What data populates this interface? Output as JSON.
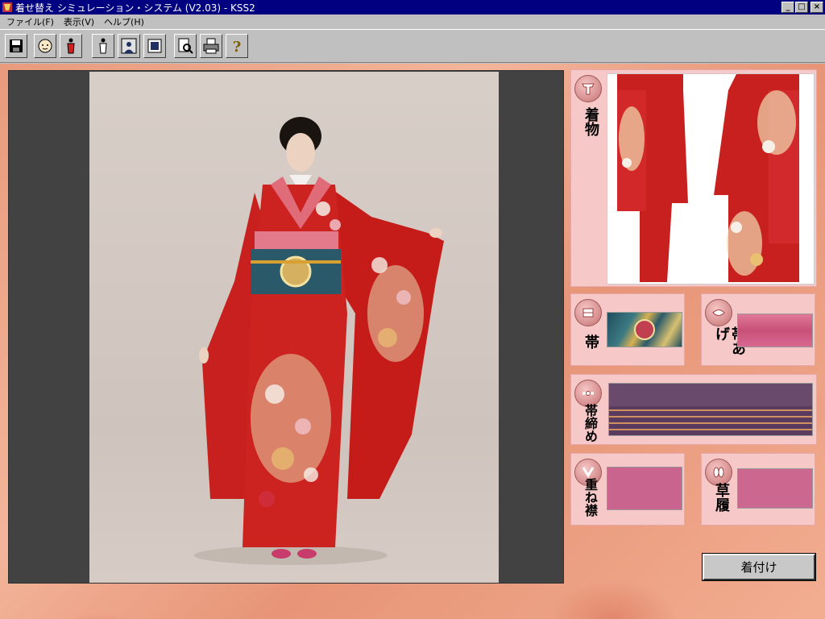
{
  "window": {
    "title": "着せ替え シミュレーション・システム (V2.03) - KSS2",
    "icon": "kimono-app-icon"
  },
  "menu": [
    {
      "label": "ファイル(F)"
    },
    {
      "label": "表示(V)"
    },
    {
      "label": "ヘルプ(H)"
    }
  ],
  "toolbar": {
    "buttons": [
      {
        "icon": "save-icon"
      },
      {
        "icon": "face-icon"
      },
      {
        "icon": "figure-red-icon"
      },
      {
        "icon": "figure-outline-icon"
      },
      {
        "icon": "portrait-icon"
      },
      {
        "icon": "book-icon"
      },
      {
        "icon": "zoom-doc-icon"
      },
      {
        "icon": "print-icon"
      },
      {
        "icon": "help-icon"
      }
    ]
  },
  "panels": {
    "kimono": {
      "label": "着物"
    },
    "obi": {
      "label": "帯"
    },
    "obiage": {
      "label": "帯あげ"
    },
    "obijime": {
      "label": "帯締め"
    },
    "kasaneeri": {
      "label": "重ね襟"
    },
    "zori": {
      "label": "草履"
    }
  },
  "colors": {
    "kimono_red": "#c8201e",
    "obiage_pink": "#d06080",
    "obijime_purple": "#5a3a5e",
    "kasaneeri_pink": "#c8648e",
    "zori_pink": "#cc6890",
    "panel_bg": "#f6c8c8",
    "title_bar": "#000080"
  },
  "apply_button": {
    "label": "着付け"
  }
}
